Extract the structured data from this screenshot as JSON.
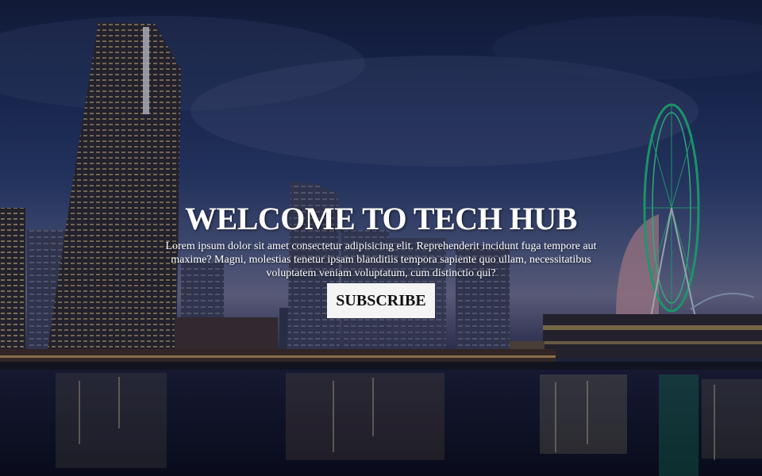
{
  "hero": {
    "title": "WELCOME TO TECH HUB",
    "subtitle": "Lorem ipsum dolor sit amet consectetur adipisicing elit. Reprehenderit incidunt fuga tempore aut maxime? Magni, molestias tenetur ipsam blanditiis tempora sapiente quo ullam, necessitatibus voluptatem veniam voluptatum, cum distinctio qui?",
    "subscribe_label": "SUBSCRIBE"
  },
  "colors": {
    "sky_top": "#141d3d",
    "sky_horizon": "#6a6c8c",
    "water": "#0d1226",
    "button_bg": "#f4f4f4",
    "ferris_wheel": "#1fb87a"
  }
}
